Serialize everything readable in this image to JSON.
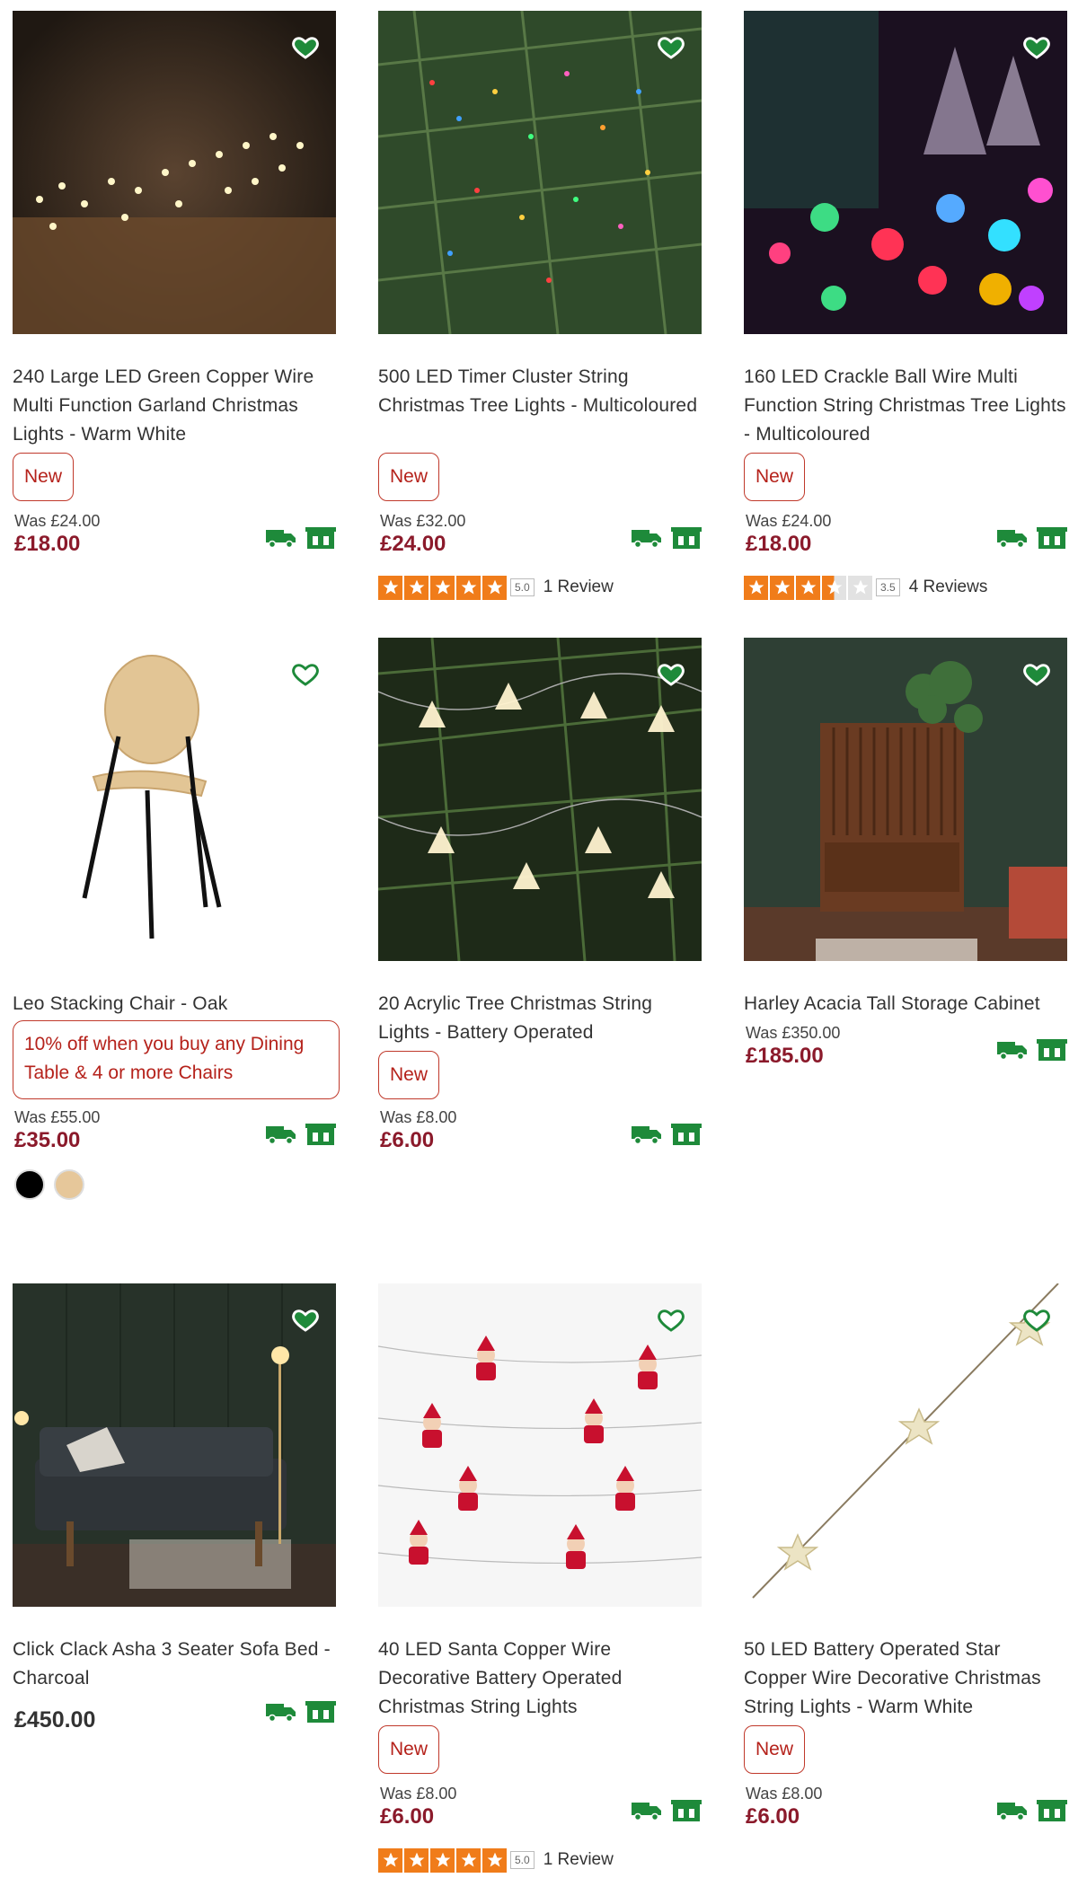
{
  "colors": {
    "accent_green": "#1e8a3a",
    "price_red": "#8b1a2b",
    "badge_red": "#b5221b",
    "star_orange": "#f07c1a"
  },
  "icons": {
    "wishlist": "heart-outline-icon",
    "delivery": "delivery-van-icon",
    "collect": "store-collect-icon",
    "star": "star-icon"
  },
  "products": [
    {
      "title": "240 Large LED Green Copper Wire Multi Function Garland Christmas Lights - Warm White",
      "badge": "New",
      "was": "Was £24.00",
      "price": "£18.00"
    },
    {
      "title": "500 LED Timer Cluster String Christmas Tree Lights - Multicoloured",
      "badge": "New",
      "was": "Was £32.00",
      "price": "£24.00",
      "rating_score": "5.0",
      "rating_value": 5,
      "reviews": "1 Review"
    },
    {
      "title": "160 LED Crackle Ball Wire Multi Function String Christmas Tree Lights - Multicoloured",
      "badge": "New",
      "was": "Was £24.00",
      "price": "£18.00",
      "rating_score": "3.5",
      "rating_value": 3.5,
      "reviews": "4 Reviews"
    },
    {
      "title": "Leo Stacking Chair - Oak",
      "promo": "10% off when you buy any Dining Table & 4 or more Chairs",
      "was": "Was £55.00",
      "price": "£35.00",
      "swatches": [
        "#000000",
        "#e6c79a"
      ]
    },
    {
      "title": "20 Acrylic Tree Christmas String Lights - Battery Operated",
      "badge": "New",
      "was": "Was £8.00",
      "price": "£6.00"
    },
    {
      "title": "Harley Acacia Tall Storage Cabinet",
      "was": "Was £350.00",
      "price": "£185.00"
    },
    {
      "title": "Click Clack Asha 3 Seater Sofa Bed - Charcoal",
      "price": "£450.00"
    },
    {
      "title": "40 LED Santa Copper Wire Decorative Battery Operated Christmas String Lights",
      "badge": "New",
      "was": "Was £8.00",
      "price": "£6.00",
      "rating_score": "5.0",
      "rating_value": 5,
      "reviews": "1 Review"
    },
    {
      "title": "50 LED Battery Operated Star Copper Wire Decorative Christmas String Lights - Warm White",
      "badge": "New",
      "was": "Was £8.00",
      "price": "£6.00"
    }
  ]
}
